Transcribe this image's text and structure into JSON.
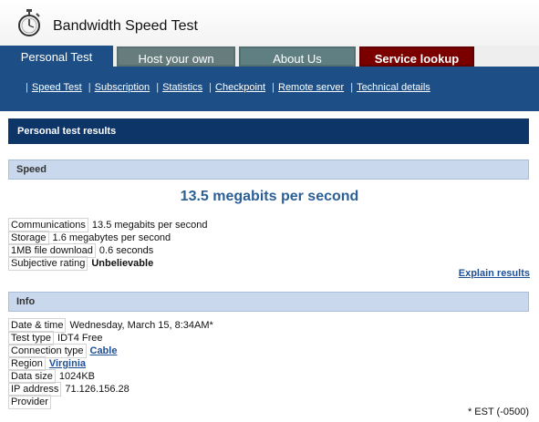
{
  "app": {
    "title": "Bandwidth Speed Test",
    "logo_icon": "stopwatch-icon"
  },
  "tabs": [
    {
      "label": "Personal Test",
      "active": true
    },
    {
      "label": "Host your own"
    },
    {
      "label": "About Us"
    },
    {
      "label": "Service lookup"
    }
  ],
  "subnav": [
    "Speed Test",
    "Subscription",
    "Statistics",
    "Checkpoint",
    "Remote server",
    "Technical details"
  ],
  "results": {
    "title": "Personal test results",
    "speed_section": "Speed",
    "headline": "13.5 megabits per second",
    "speed_rows": [
      {
        "label": "Communications",
        "value": "13.5 megabits per second"
      },
      {
        "label": "Storage",
        "value": "1.6 megabytes per second"
      },
      {
        "label": "1MB file download",
        "value": "0.6 seconds"
      },
      {
        "label": "Subjective rating",
        "value": "Unbelievable"
      }
    ],
    "explain_link": "Explain results",
    "info_section": "Info",
    "info_rows": [
      {
        "label": "Date & time",
        "value": "Wednesday, March 15, 8:34AM*"
      },
      {
        "label": "Test type",
        "value": "IDT4 Free"
      },
      {
        "label": "Connection type",
        "value": "Cable"
      },
      {
        "label": "Region",
        "value": "Virginia"
      },
      {
        "label": "Data size",
        "value": "1024KB"
      },
      {
        "label": "IP address",
        "value": "71.126.156.28"
      },
      {
        "label": "Provider",
        "value": ""
      }
    ],
    "footnote": "* EST (-0500)"
  },
  "colors": {
    "nav_blue": "#1d4f86",
    "results_bar": "#0d3568",
    "service_tab": "#7a0000",
    "link": "#1f4f94"
  }
}
